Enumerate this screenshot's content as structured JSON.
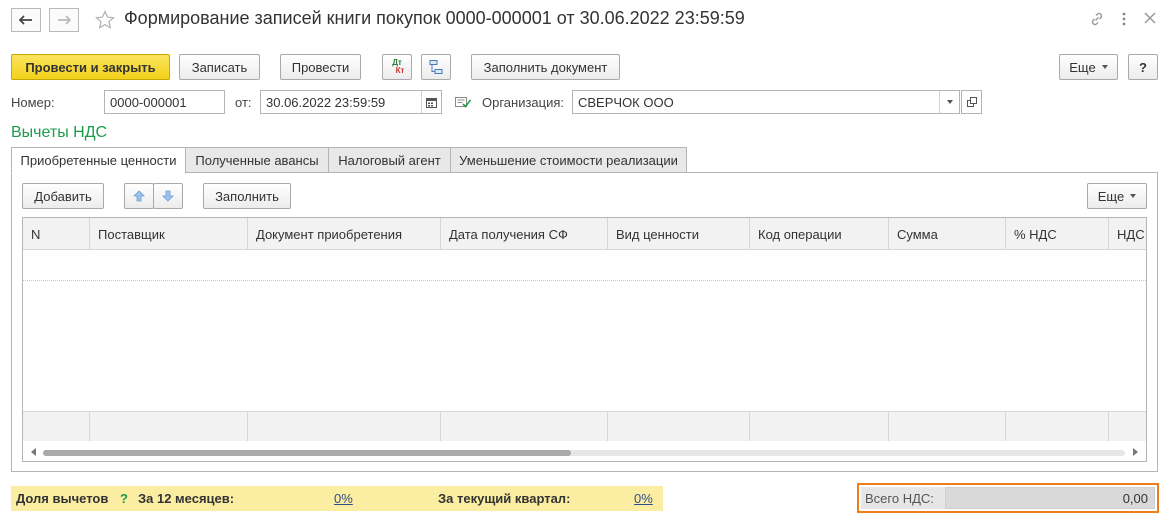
{
  "window": {
    "title": "Формирование записей книги покупок 0000-000001 от 30.06.2022 23:59:59",
    "icons": [
      "back-arrow",
      "forward-arrow",
      "favorite-star",
      "link-icon",
      "more-vertical-icon",
      "close-icon"
    ]
  },
  "toolbar": {
    "post_close_label": "Провести и закрыть",
    "save_label": "Записать",
    "post_label": "Провести",
    "dt_kt_top": "Дт",
    "dt_kt_bottom": "Кт",
    "fill_doc_label": "Заполнить документ",
    "more_label": "Еще",
    "help_label": "?"
  },
  "header": {
    "number_label": "Номер:",
    "number_value": "0000-000001",
    "date_label": "от:",
    "date_value": "30.06.2022 23:59:59",
    "org_label": "Организация:",
    "org_value": "СВЕРЧОК ООО"
  },
  "section": {
    "title": "Вычеты НДС"
  },
  "tabs": [
    {
      "label": "Приобретенные ценности",
      "active": true
    },
    {
      "label": "Полученные авансы",
      "active": false
    },
    {
      "label": "Налоговый агент",
      "active": false
    },
    {
      "label": "Уменьшение стоимости реализации",
      "active": false
    }
  ],
  "table_toolbar": {
    "add_label": "Добавить",
    "fill_label": "Заполнить",
    "more_label": "Еще"
  },
  "table": {
    "columns": [
      "N",
      "Поставщик",
      "Документ приобретения",
      "Дата получения СФ",
      "Вид ценности",
      "Код операции",
      "Сумма",
      "% НДС",
      "НДС"
    ],
    "rows": []
  },
  "footer": {
    "share_label": "Доля вычетов",
    "help_mark": "?",
    "months_label": "За 12 месяцев:",
    "months_value": "0%",
    "quarter_label": "За текущий квартал:",
    "quarter_value": "0%",
    "total_label": "Всего НДС:",
    "total_value": "0,00"
  },
  "colors": {
    "accent_yellow": "#f3d21a",
    "section_green": "#1d9b4b",
    "footer_bg": "#fbeda1",
    "total_border": "#ef7d1a",
    "link_blue": "#2f4e8c"
  }
}
